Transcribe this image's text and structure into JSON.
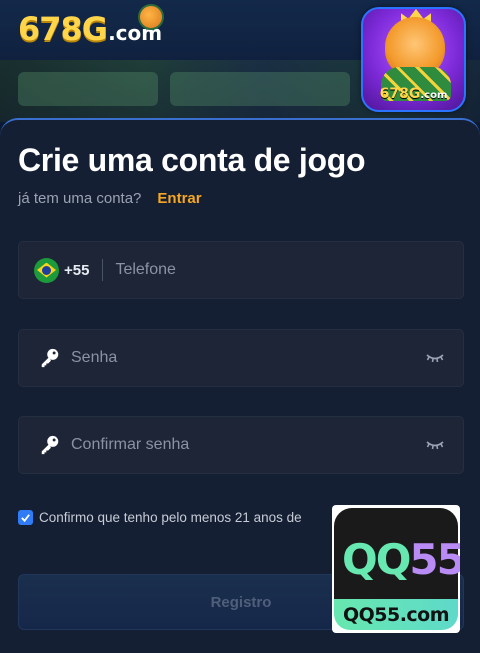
{
  "header": {
    "logo_number": "678G",
    "logo_domain": ".com",
    "app_icon_label_main": "678G",
    "app_icon_label_suffix": ".com"
  },
  "form": {
    "title": "Crie uma conta de jogo",
    "have_account_text": "já tem uma conta?",
    "login_link": "Entrar",
    "phone": {
      "country_flag": "brazil-flag-icon",
      "dial_code": "+55",
      "placeholder": "Telefone"
    },
    "password": {
      "placeholder": "Senha",
      "icon": "key-icon",
      "toggle_icon": "eye-closed-icon"
    },
    "confirm_password": {
      "placeholder": "Confirmar senha",
      "icon": "key-icon",
      "toggle_icon": "eye-closed-icon"
    },
    "age_consent": {
      "checked": true,
      "text": "Confirmo que tenho pelo menos 21 anos de"
    },
    "register_button": "Registro"
  },
  "watermark": {
    "top_text_a": "QQ",
    "top_text_b": "55",
    "bottom_text": "QQ55.com"
  },
  "colors": {
    "accent_link": "#f5a623",
    "checkbox": "#2f7cf6",
    "panel_bg": "#151f33",
    "field_bg": "#1d2536"
  }
}
